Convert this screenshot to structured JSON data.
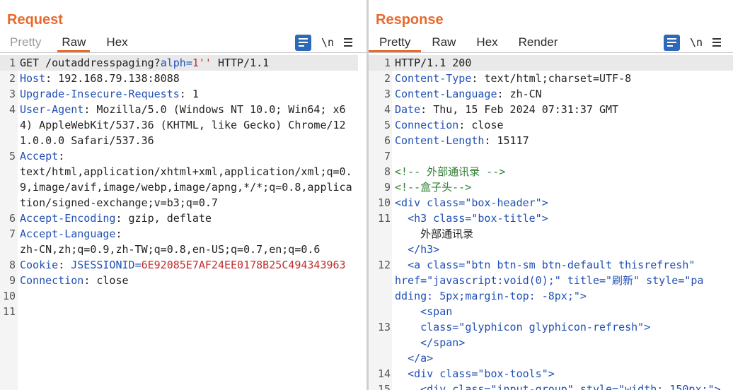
{
  "layout_switch": {
    "items": [
      {
        "name": "side-by-side",
        "active": true
      },
      {
        "name": "stacked",
        "active": false
      },
      {
        "name": "single",
        "active": false
      }
    ]
  },
  "request": {
    "title": "Request",
    "tabs": [
      {
        "label": "Pretty",
        "state": "disabled"
      },
      {
        "label": "Raw",
        "state": "active"
      },
      {
        "label": "Hex",
        "state": "normal"
      }
    ],
    "tools": {
      "newline_label": "\\n"
    },
    "lines": [
      {
        "n": "1",
        "method": "GET",
        "path": "/outaddresspaging?",
        "param_name": "alph",
        "eq": "=",
        "param_val": "1''",
        "proto": " HTTP/1.1"
      },
      {
        "n": "2",
        "key": "Host",
        "sep": ": ",
        "val": "192.168.79.138:8088"
      },
      {
        "n": "3",
        "key": "Upgrade-Insecure-Requests",
        "sep": ": ",
        "val": "1"
      },
      {
        "n": "4",
        "key": "User-Agent",
        "sep": ": ",
        "val": "Mozilla/5.0 (Windows NT 10.0; Win64; x64) AppleWebKit/537.36 (KHTML, like Gecko) Chrome/121.0.0.0 Safari/537.36"
      },
      {
        "n": "5",
        "key": "Accept",
        "sep": ":",
        "val": "text/html,application/xhtml+xml,application/xml;q=0.9,image/avif,image/webp,image/apng,*/*;q=0.8,application/signed-exchange;v=b3;q=0.7"
      },
      {
        "n": "6",
        "key": "Accept-Encoding",
        "sep": ": ",
        "val": "gzip, deflate"
      },
      {
        "n": "7",
        "key": "Accept-Language",
        "sep": ":",
        "val": "zh-CN,zh;q=0.9,zh-TW;q=0.8,en-US;q=0.7,en;q=0.6"
      },
      {
        "n": "8",
        "key": "Cookie",
        "sep": ": ",
        "cookie_name": "JSESSIONID",
        "cookie_eq": "=",
        "cookie_val": "6E92085E7AF24EE0178B25C494343963"
      },
      {
        "n": "9",
        "key": "Connection",
        "sep": ": ",
        "val": "close"
      },
      {
        "n": "10",
        "text": ""
      },
      {
        "n": "11",
        "text": ""
      }
    ]
  },
  "response": {
    "title": "Response",
    "tabs": [
      {
        "label": "Pretty",
        "state": "active"
      },
      {
        "label": "Raw",
        "state": "normal"
      },
      {
        "label": "Hex",
        "state": "normal"
      },
      {
        "label": "Render",
        "state": "normal"
      }
    ],
    "tools": {
      "newline_label": "\\n"
    },
    "lines": [
      {
        "n": "1",
        "text": "HTTP/1.1 200"
      },
      {
        "n": "2",
        "key": "Content-Type",
        "sep": ": ",
        "val": "text/html;charset=UTF-8"
      },
      {
        "n": "3",
        "key": "Content-Language",
        "sep": ": ",
        "val": "zh-CN"
      },
      {
        "n": "4",
        "key": "Date",
        "sep": ": ",
        "val": "Thu, 15 Feb 2024 07:31:37 GMT"
      },
      {
        "n": "5",
        "key": "Connection",
        "sep": ": ",
        "val": "close"
      },
      {
        "n": "6",
        "key": "Content-Length",
        "sep": ": ",
        "val": "15117"
      },
      {
        "n": "7",
        "text": ""
      },
      {
        "n": "8",
        "comment": "<!-- 外部通讯录 -->"
      },
      {
        "n": "9",
        "comment": "<!--盒子头-->"
      },
      {
        "n": "10",
        "html": "<div class=\"box-header\">"
      },
      {
        "n": "11",
        "html": "  <h3 class=\"box-title\">",
        "extra": [
          "    外部通讯录",
          "  </h3>"
        ]
      },
      {
        "n": "12",
        "html": "  <a class=\"btn btn-sm btn-default thisrefresh\" href=\"javascript:void(0);\" title=\"刷新\" style=\"padding: 5px;margin-top: -8px;\">",
        "extra": [
          "    <span"
        ]
      },
      {
        "n": "13",
        "html": "    class=\"glyphicon glyphicon-refresh\">",
        "extra": [
          "    </span>",
          "  </a>"
        ]
      },
      {
        "n": "14",
        "html": "  <div class=\"box-tools\">"
      },
      {
        "n": "15",
        "html": "    <div class=\"input-group\" style=\"width: 150px;\">"
      }
    ]
  }
}
